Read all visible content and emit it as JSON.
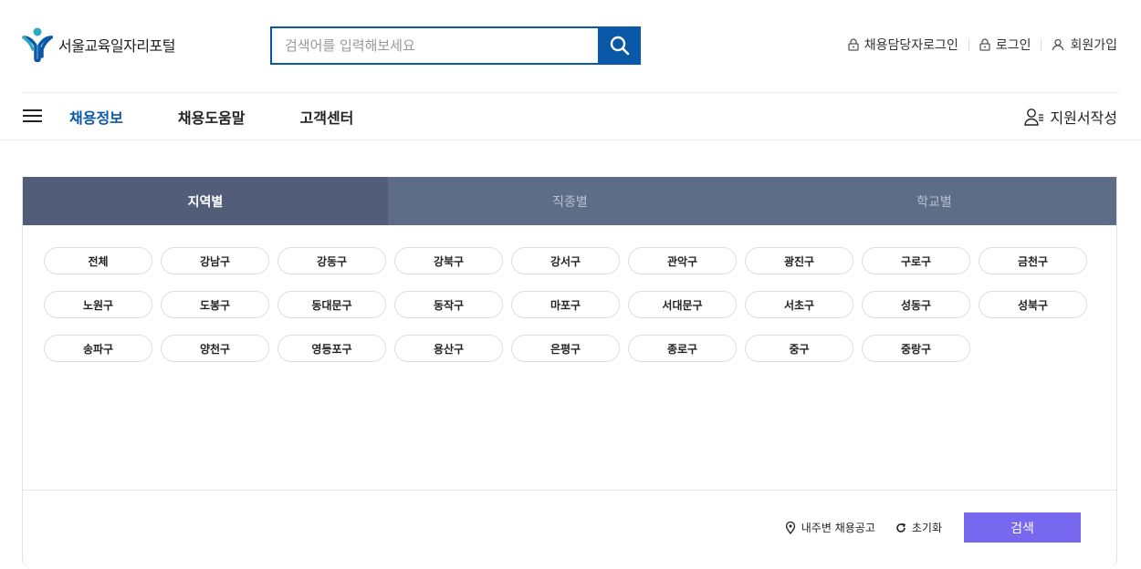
{
  "header": {
    "logo_text": "서울교육일자리포털",
    "search_placeholder": "검색어를 입력해보세요",
    "util_links": [
      "채용담당자로그인",
      "로그인",
      "회원가입"
    ]
  },
  "nav": {
    "items": [
      "채용정보",
      "채용도움말",
      "고객센터"
    ],
    "active_index": 0,
    "apply_label": "지원서작성"
  },
  "tabs": [
    {
      "label": "지역별",
      "active": true
    },
    {
      "label": "직종별",
      "active": false
    },
    {
      "label": "학교별",
      "active": false
    }
  ],
  "districts": [
    "전체",
    "강남구",
    "강동구",
    "강북구",
    "강서구",
    "관악구",
    "광진구",
    "구로구",
    "금천구",
    "노원구",
    "도봉구",
    "동대문구",
    "동작구",
    "마포구",
    "서대문구",
    "서초구",
    "성동구",
    "성북구",
    "송파구",
    "양천구",
    "영등포구",
    "용산구",
    "은평구",
    "종로구",
    "중구",
    "중랑구"
  ],
  "footer": {
    "nearby_label": "내주변 채용공고",
    "reset_label": "초기화",
    "search_label": "검색"
  },
  "colors": {
    "brand_blue": "#0a58a8",
    "tab_active": "#525e79",
    "tab_inactive": "#5e6d87",
    "search_button": "#7868f0"
  },
  "icons": [
    "logo-mark",
    "search-icon",
    "lock-icon",
    "user-icon",
    "menu-icon",
    "apply-user-icon",
    "location-pin-icon",
    "refresh-icon"
  ]
}
